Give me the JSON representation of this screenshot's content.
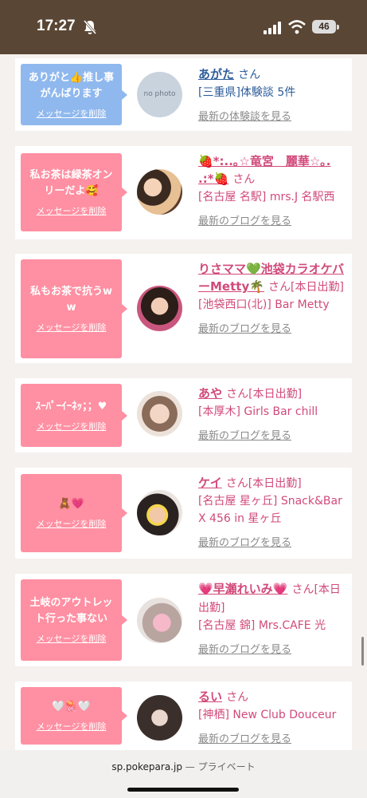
{
  "status": {
    "time": "17:27",
    "battery": "46"
  },
  "items": [
    {
      "message": "ありがと👍推し事がんばります",
      "delete_label": "メッセージを削除",
      "avatar_text": "no photo",
      "name": "あがた",
      "san": "さん",
      "location": "[三重県]体験談 5件",
      "more": "最新の体験談を見る",
      "theme": "blue"
    },
    {
      "message": "私お茶は緑茶オンリーだよ🥰",
      "delete_label": "メッセージを削除",
      "name": "🍓*:..｡☆竜宮　麗華☆｡. .:*🍓",
      "san": "さん",
      "location": "[名古屋 名駅] mrs.J 名駅西",
      "more": "最新のブログを見る",
      "theme": "pink"
    },
    {
      "message": "私もお茶で抗うww",
      "delete_label": "メッセージを削除",
      "name": "りさママ💚池袋カラオケバーMetty🌴",
      "san": "さん[本日出勤]",
      "location": "[池袋西口(北)] Bar Metty",
      "more": "最新のブログを見る",
      "theme": "pink"
    },
    {
      "message": "ｽｰﾊﾟｰｲｰﾈｯ；；♥",
      "delete_label": "メッセージを削除",
      "name": "あや",
      "san": "さん[本日出勤]",
      "location": "[本厚木] Girls Bar chill",
      "more": "最新のブログを見る",
      "theme": "pink"
    },
    {
      "message": "🧸💗",
      "delete_label": "メッセージを削除",
      "name": "ケイ",
      "san": "さん[本日出勤]",
      "location": "[名古屋 星ヶ丘] Snack&Bar X 456 in 星ヶ丘",
      "more": "最新のブログを見る",
      "theme": "pink"
    },
    {
      "message": "土岐のアウトレット行った事ない",
      "delete_label": "メッセージを削除",
      "name": "💗早瀬れいみ💗",
      "san": "さん[本日出勤]",
      "location": "[名古屋 錦] Mrs.CAFE 光",
      "more": "最新のブログを見る",
      "theme": "pink"
    },
    {
      "message": "🤍🪼🤍",
      "delete_label": "メッセージを削除",
      "name": "るい",
      "san": "さん",
      "location": "[神栖] New Club Douceur",
      "more": "最新のブログを見る",
      "theme": "pink"
    }
  ],
  "url_bar": {
    "domain": "sp.pokepara.jp",
    "separator": "—",
    "mode": "プライベート"
  },
  "colors": {
    "pink": "#ff8fa2",
    "blue": "#8fb8ee",
    "name_pink": "#d14a7a",
    "name_blue": "#2d5c9a",
    "status_bg": "#5a4634"
  }
}
